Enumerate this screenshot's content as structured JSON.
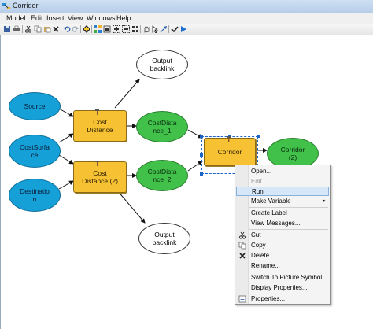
{
  "window": {
    "title": "Corridor"
  },
  "menu": {
    "items": [
      "Model",
      "Edit",
      "Insert",
      "View",
      "Windows",
      "Help"
    ]
  },
  "toolbar": {
    "icons": [
      "save-icon",
      "print-icon",
      "cut-icon",
      "copy-icon",
      "paste-icon",
      "delete-icon",
      "undo-icon",
      "redo-icon",
      "add-data-icon",
      "auto-layout-icon",
      "full-extent-icon",
      "zoom-in-icon",
      "zoom-out-icon",
      "pan-icon",
      "select-icon",
      "connect-icon",
      "validate-icon",
      "run-icon"
    ]
  },
  "model": {
    "nodes": {
      "source": "Source",
      "costsurface": "CostSurfa\nce",
      "destination": "Destinatio\nn",
      "tool_cost1": "Cost\nDistance",
      "tool_cost2": "Cost\nDistance (2)",
      "out_cd1": "CostDista\nnce_1",
      "out_cd2": "CostDista\nnce_2",
      "out_backlink1": "Output\nbacklink",
      "out_backlink2": "Output\nbacklink",
      "tool_corridor": "Corridor",
      "out_corridor": "Corridor\n(2)"
    }
  },
  "context_menu": {
    "items": [
      {
        "label": "Open...",
        "enabled": true
      },
      {
        "label": "Edit...",
        "enabled": false
      },
      {
        "label": "Run",
        "enabled": true,
        "highlighted": true
      },
      {
        "label": "Make Variable",
        "enabled": true,
        "submenu": true
      },
      {
        "label": "Create Label",
        "enabled": true
      },
      {
        "label": "View Messages...",
        "enabled": true
      },
      {
        "label": "Cut",
        "enabled": true,
        "icon": "cut-icon"
      },
      {
        "label": "Copy",
        "enabled": true,
        "icon": "copy-icon"
      },
      {
        "label": "Delete",
        "enabled": true,
        "icon": "delete-icon"
      },
      {
        "label": "Rename...",
        "enabled": true
      },
      {
        "label": "Switch To Picture Symbol",
        "enabled": true
      },
      {
        "label": "Display Properties...",
        "enabled": true
      },
      {
        "label": "Properties...",
        "enabled": true,
        "icon": "properties-icon"
      }
    ]
  },
  "colors": {
    "input_variable": "#15a0d8",
    "tool": "#f6c233",
    "derived_output": "#41c04a",
    "unused_output": "#ffffff",
    "menu_highlight": "#d6e7f8"
  }
}
